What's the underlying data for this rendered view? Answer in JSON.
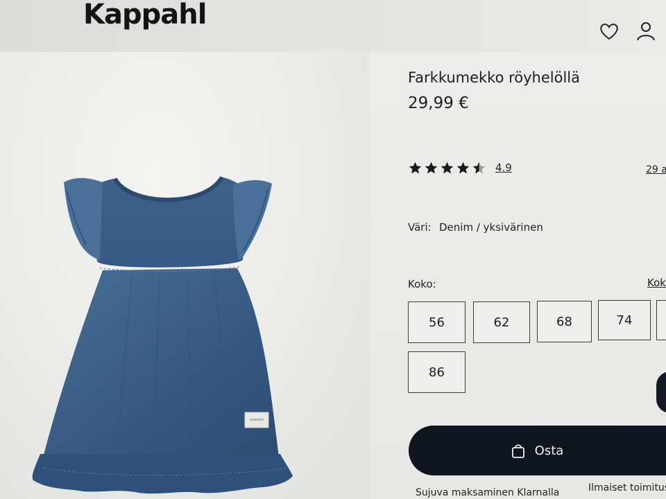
{
  "header": {
    "logo": "Kappahl",
    "icons": [
      "heart-icon",
      "user-icon"
    ]
  },
  "product": {
    "title": "Farkkumekko röyhelöllä",
    "price": "29,99 €",
    "rating": {
      "value_label": "4.9",
      "stars": 4.5,
      "max_stars": 5
    },
    "reviews_link": "29 a",
    "color_label": "Väri:",
    "color_value": "Denim / yksivärinen",
    "size_label": "Koko:",
    "size_guide_link": "Koko",
    "sizes": [
      "56",
      "62",
      "68",
      "74",
      "86"
    ],
    "buy_label": "Osta",
    "buy_icon": "shopping-bag-icon",
    "image_icon": "dress-icon"
  },
  "footer": {
    "klarna": "Sujuva maksaminen Klarnalla",
    "delivery": "Ilmaiset toimitus"
  },
  "colors": {
    "buy_button": "#0f1620",
    "denim": "#3b5f86",
    "background": "#ececea"
  }
}
